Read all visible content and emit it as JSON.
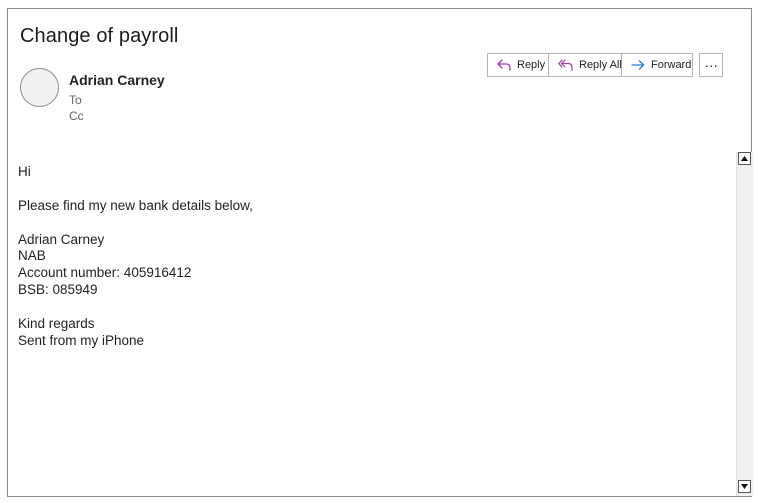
{
  "email": {
    "subject": "Change of payroll",
    "sender": "Adrian Carney",
    "to_label": "To",
    "cc_label": "Cc"
  },
  "actions": {
    "reply": "Reply",
    "reply_all": "Reply All",
    "forward": "Forward",
    "more": "…"
  },
  "icons": {
    "reply": "reply-icon",
    "reply_all": "reply-all-icon",
    "forward": "forward-icon",
    "more": "more-icon"
  },
  "colors": {
    "reply_icon": "#a23ca6",
    "forward_icon": "#2b7cd3",
    "border": "#8a8a8a"
  },
  "body": {
    "greeting": "Hi",
    "intro": "Please find my new bank details below,",
    "name": "Adrian Carney",
    "bank": "NAB",
    "account": "Account number: 405916412",
    "bsb": "BSB: 085949",
    "signoff": "Kind regards",
    "signature": "Sent from my iPhone"
  }
}
